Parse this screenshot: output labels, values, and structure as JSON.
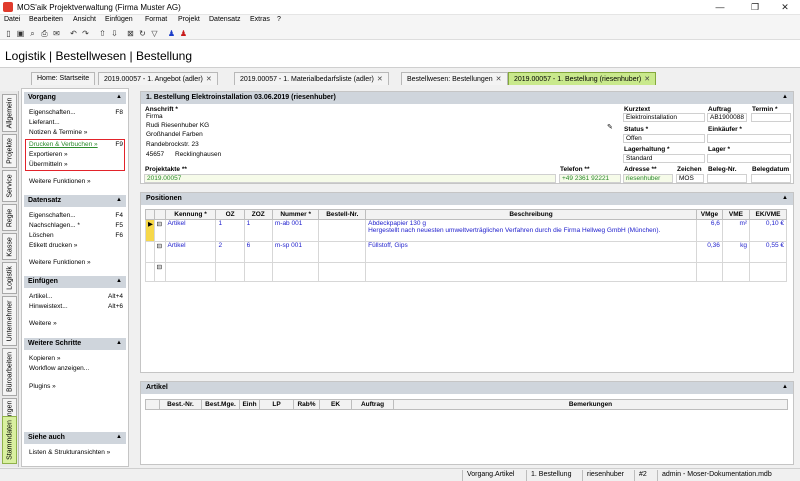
{
  "window": {
    "title": "MOS'aik Projektverwaltung (Firma Muster AG)",
    "minimize": "—",
    "maximize": "❐",
    "close": "✕"
  },
  "menu": [
    "Datei",
    "Bearbeiten",
    "Ansicht",
    "Einfügen",
    "Format",
    "Projekt",
    "Datensatz",
    "Extras",
    "?"
  ],
  "toolbar_icons": [
    "new-doc-icon",
    "save-icon",
    "print-preview-icon",
    "print-icon",
    "mail-icon",
    "undo-icon",
    "redo-icon",
    "arrow-up-icon",
    "arrow-down-icon",
    "delete-icon",
    "refresh-icon",
    "filter-icon",
    "user-blue-icon",
    "user-red-icon"
  ],
  "page_title": "Logistik | Bestellwesen | Bestellung",
  "doc_tabs": [
    {
      "label": "Home: Startseite",
      "closable": false
    },
    {
      "label": "2019.00057 - 1. Angebot (adler)",
      "closable": true
    },
    {
      "label": "2019.00057 - 1. Materialbedarfsliste (adler)",
      "closable": true
    },
    {
      "label": "Bestellwesen: Bestellungen",
      "closable": true
    },
    {
      "label": "2019.00057 - 1. Bestellung (riesenhuber)",
      "closable": true
    }
  ],
  "vertical_tabs": [
    "Allgemein",
    "Projekte",
    "Service",
    "Regie",
    "Kasse",
    "Logistik",
    "Unternehmer",
    "Büroarbeiten",
    "Auswertungen",
    "Stammdaten"
  ],
  "taskpane": {
    "vorgang": {
      "title": "Vorgang",
      "items": [
        {
          "label": "Eigenschaften...",
          "key": "F8"
        },
        {
          "label": "Lieferant...",
          "key": ""
        },
        {
          "label": "Notizen & Termine »",
          "key": ""
        },
        {
          "label": "Drucken & Verbuchen »",
          "key": "F9"
        },
        {
          "label": "Exportieren »",
          "key": ""
        },
        {
          "label": "Übermitteln »",
          "key": ""
        },
        {
          "label": "Weitere Funktionen »",
          "key": ""
        }
      ]
    },
    "datensatz": {
      "title": "Datensatz",
      "items": [
        {
          "label": "Eigenschaften...",
          "key": "F4"
        },
        {
          "label": "Nachschlagen... *",
          "key": "F5"
        },
        {
          "label": "Löschen",
          "key": "F6"
        },
        {
          "label": "Etikett drucken »",
          "key": ""
        },
        {
          "label": "Weitere Funktionen »",
          "key": ""
        }
      ]
    },
    "einfuegen": {
      "title": "Einfügen",
      "items": [
        {
          "label": "Artikel...",
          "key": "Alt+4"
        },
        {
          "label": "Hinweistext...",
          "key": "Alt+6"
        },
        {
          "label": "Weitere »",
          "key": ""
        }
      ]
    },
    "weitere": {
      "title": "Weitere Schritte",
      "items": [
        {
          "label": "Kopieren »",
          "key": ""
        },
        {
          "label": "Workflow anzeigen...",
          "key": ""
        },
        {
          "label": "Plugins »",
          "key": ""
        }
      ]
    },
    "siehe": {
      "title": "Siehe auch",
      "items": [
        {
          "label": "Listen & Strukturansichten »",
          "key": ""
        }
      ]
    }
  },
  "header_panel": {
    "title": "1. Bestellung Elektroinstallation 03.06.2019 (riesenhuber)",
    "anschrift_label": "Anschrift *",
    "anschrift": [
      "Firma",
      "Rudi Riesenhuber KG",
      "Großhandel Farben",
      "Randebrockstr. 23"
    ],
    "plz": "45657",
    "ort": "Recklinghausen",
    "kurztext_label": "Kurztext",
    "kurztext": "Elektroinstallation",
    "auftrag_label": "Auftrag",
    "auftrag": "AB1900088",
    "termin_label": "Termin *",
    "termin": "",
    "status_label": "Status *",
    "status": "Offen",
    "einkaeufer_label": "Einkäufer *",
    "lagerhaltung_label": "Lagerhaltung *",
    "lagerhaltung": "Standard",
    "lager_label": "Lager *",
    "projektakte_label": "Projektakte **",
    "projektakte": "2019.00057",
    "telefon_label": "Telefon **",
    "telefon": "+49 2361 92221",
    "adresse_label": "Adresse **",
    "adresse": "riesenhuber",
    "zeichen_label": "Zeichen",
    "zeichen": "MOS",
    "belegnr_label": "Beleg-Nr.",
    "belegdatum_label": "Belegdatum"
  },
  "positionen": {
    "title": "Positionen",
    "columns": [
      "Kennung *",
      "OZ",
      "ZOZ",
      "Nummer *",
      "Bestell-Nr.",
      "Beschreibung",
      "VMge",
      "VME",
      "EK/VME"
    ],
    "rows": [
      {
        "kennung": "Artikel",
        "oz": "1",
        "zoz": "1",
        "nummer": "m-ab 001",
        "bestellnr": "",
        "beschreibung": "Abdeckpapier 130 g",
        "beschreibung2": "Hergestellt nach neuesten umweltverträglichen Verfahren durch die Firma Hellweg GmbH (München).",
        "vmge": "6,6",
        "vme": "m²",
        "ek": "0,10 €"
      },
      {
        "kennung": "Artikel",
        "oz": "2",
        "zoz": "6",
        "nummer": "m-sp 001",
        "bestellnr": "",
        "beschreibung": "Füllstoff, Gips",
        "beschreibung2": "",
        "vmge": "0,36",
        "vme": "kg",
        "ek": "0,55 €"
      }
    ]
  },
  "artikel": {
    "title": "Artikel",
    "columns": [
      "Best.-Nr.",
      "Best.Mge.",
      "Einh",
      "LP",
      "Rab%",
      "EK",
      "Auftrag",
      "Bemerkungen"
    ]
  },
  "statusbar": [
    "Vorgang.Artikel",
    "1. Bestellung",
    "riesenhuber",
    "#2",
    "admin - Moser-Dokumentation.mdb"
  ]
}
